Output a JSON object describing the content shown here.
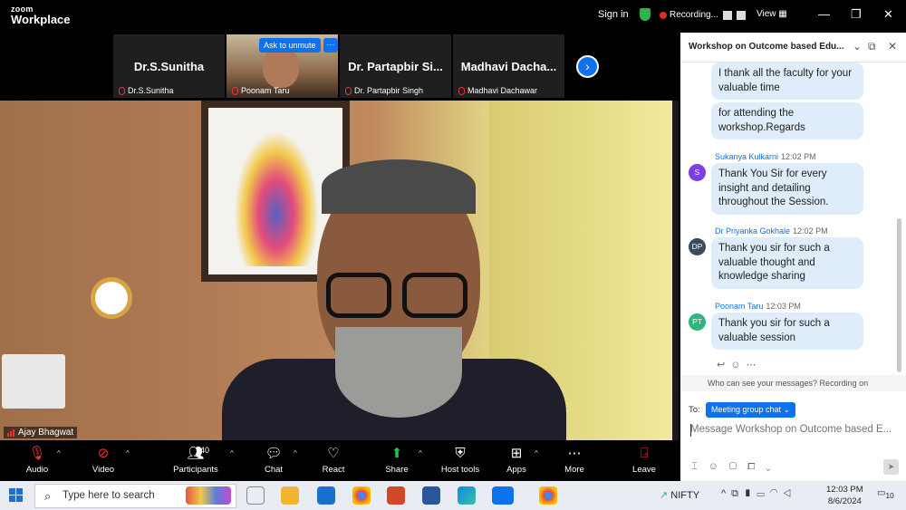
{
  "app": {
    "logo_line1": "zoom",
    "logo_line2": "Workplace",
    "signin": "Sign in",
    "recording": "Recording...",
    "view": "View"
  },
  "window_controls": {
    "minimize": "—",
    "restore": "❐",
    "close": "✕"
  },
  "thumbnails": [
    {
      "big": "Dr.S.Sunitha",
      "name": "Dr.S.Sunitha"
    },
    {
      "big": "",
      "name": "Poonam Taru"
    },
    {
      "big": "Dr. Partapbir Si...",
      "name": "Dr. Partapbir Singh"
    },
    {
      "big": "Madhavi Dacha...",
      "name": "Madhavi Dachawar"
    }
  ],
  "ask_to_unmute": "Ask to unmute",
  "more_dots": "···",
  "speaker": {
    "name": "Ajay Bhagwat"
  },
  "toolbar": {
    "audio": "Audio",
    "video": "Video",
    "participants": "Participants",
    "participants_count": "40",
    "chat": "Chat",
    "react": "React",
    "share": "Share",
    "host_tools": "Host tools",
    "apps": "Apps",
    "more": "More",
    "leave": "Leave"
  },
  "chat": {
    "title": "Workshop on Outcome based Edu...",
    "messages": [
      {
        "text": "I thank all the faculty for your valuable time"
      },
      {
        "text": "for attending the workshop.Regards"
      },
      {
        "sender": "Sukanya Kulkarni",
        "time": "12:02 PM",
        "avatar": "S",
        "avatar_color": "#7b3fe4",
        "text": "Thank You Sir for every insight and detailing throughout the Session."
      },
      {
        "sender": "Dr Priyanka Gokhale",
        "time": "12:02 PM",
        "avatar": "DP",
        "avatar_color": "#3b4a5a",
        "text": "Thank you sir for such a valuable thought and knowledge sharing"
      },
      {
        "sender": "Poonam Taru",
        "time": "12:03 PM",
        "avatar": "PT",
        "avatar_color": "#2eb67d",
        "text": "Thank you sir for such a valuable session"
      }
    ],
    "notice": "Who can see your messages? Recording on",
    "to_label": "To:",
    "to_value": "Meeting group chat",
    "input_placeholder": "Message Workshop on Outcome based E..."
  },
  "taskbar": {
    "search_placeholder": "Type here to search",
    "nifty": "NIFTY",
    "time": "12:03 PM",
    "date": "8/6/2024",
    "notif_count": "10"
  },
  "colors": {
    "accent": "#0e72ed",
    "share_green": "#23c24a"
  }
}
